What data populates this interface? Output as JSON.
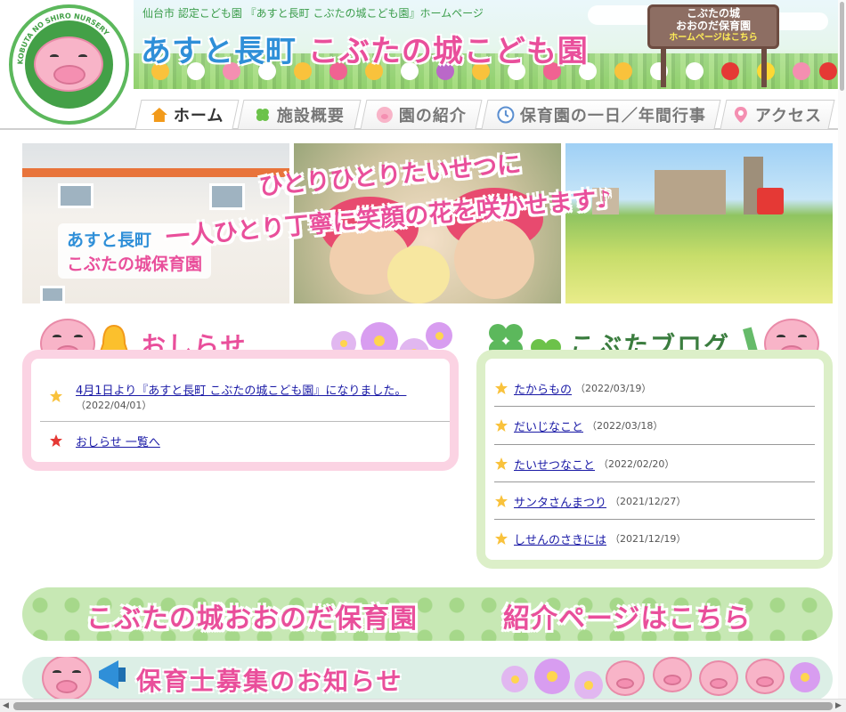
{
  "header": {
    "tagline": "仙台市 認定こども園 『あすと長町 こぶたの城こども園』ホームページ",
    "title_part1": "あすと長町",
    "title_part2": "こぶたの城こども園",
    "logo_ring_text": "KOBUTA NO SHIRO NURSERY",
    "sign": {
      "line1": "こぶたの城",
      "line2": "おおのだ保育園",
      "line3": "ホームページはこちら"
    }
  },
  "nav": {
    "items": [
      {
        "label": "ホーム",
        "icon": "home-icon",
        "active": true
      },
      {
        "label": "施設概要",
        "icon": "clover-icon"
      },
      {
        "label": "園の紹介",
        "icon": "pig-icon"
      },
      {
        "label": "保育園の一日／年間行事",
        "icon": "clock-icon"
      },
      {
        "label": "アクセス",
        "icon": "map-pin-icon"
      }
    ]
  },
  "hero": {
    "copy_line1": "ひとりひとりたいせつに",
    "copy_line2": "一人ひとり丁寧に笑顔の花を咲かせます♪",
    "school_line1": "あすと長町",
    "school_line2": "こぶたの城保育園"
  },
  "news": {
    "title": "おしらせ",
    "items": [
      {
        "text": "4月1日より『あすと長町 こぶたの城こども園』になりました。",
        "date": "（2022/04/01）"
      }
    ],
    "more_link": "おしらせ 一覧へ"
  },
  "blog": {
    "title": "こぶたブログ",
    "posts": [
      {
        "title": "たからもの",
        "date": "（2022/03/19）"
      },
      {
        "title": "だいじなこと",
        "date": "（2022/03/18）"
      },
      {
        "title": "たいせつなこと",
        "date": "（2022/02/20）"
      },
      {
        "title": "サンタさんまつり",
        "date": "（2021/12/27）"
      },
      {
        "title": "しせんのさきには",
        "date": "（2021/12/19）"
      }
    ]
  },
  "banners": {
    "onoda_name": "こぶたの城おおのだ保育園",
    "onoda_link": "紹介ページはこちら",
    "recruit": "保育士募集のお知らせ"
  },
  "colors": {
    "pink": "#e94f9b",
    "blue": "#2f8fd8",
    "green": "#3a9c4a",
    "news_border": "#fbd3e3",
    "blog_border": "#dcefc8"
  }
}
